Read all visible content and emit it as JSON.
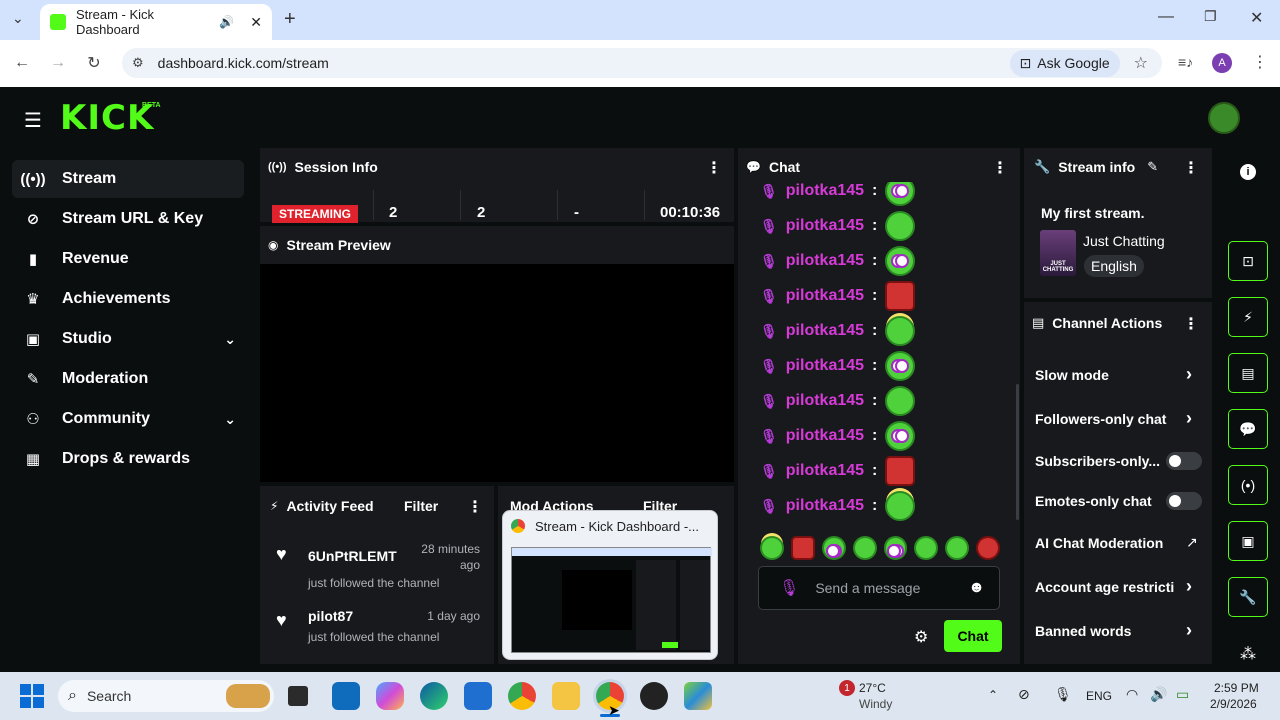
{
  "browser": {
    "tab_title": "Stream - Kick Dashboard",
    "url": "dashboard.kick.com/stream",
    "ask_google": "Ask Google",
    "profile_initial": "A"
  },
  "kick": {
    "logo": "KICK",
    "beta": "BETA"
  },
  "sidebar": {
    "items": [
      {
        "label": "Stream",
        "icon": "radio-icon"
      },
      {
        "label": "Stream URL & Key",
        "icon": "link-icon"
      },
      {
        "label": "Revenue",
        "icon": "chart-icon"
      },
      {
        "label": "Achievements",
        "icon": "trophy-icon"
      },
      {
        "label": "Studio",
        "icon": "studio-icon"
      },
      {
        "label": "Moderation",
        "icon": "wrench-icon"
      },
      {
        "label": "Community",
        "icon": "people-icon"
      },
      {
        "label": "Drops & rewards",
        "icon": "gift-icon"
      }
    ]
  },
  "session_info": {
    "title": "Session Info",
    "status": "STREAMING",
    "viewers": "2",
    "followers": "2",
    "subs": "-",
    "duration": "00:10:36"
  },
  "stream_preview": {
    "title": "Stream Preview"
  },
  "activity_feed": {
    "title": "Activity Feed",
    "filter": "Filter",
    "items": [
      {
        "user": "6UnPtRLEMT",
        "time": "28 minutes ago",
        "action": "just followed the channel"
      },
      {
        "user": "pilot87",
        "time": "1 day ago",
        "action": "just followed the channel"
      }
    ]
  },
  "mod_actions": {
    "title": "Mod Actions",
    "filter": "Filter"
  },
  "thumbnail_popup": {
    "title": "Stream - Kick Dashboard -..."
  },
  "chat": {
    "title": "Chat",
    "username": "pilotka145",
    "separator": ":",
    "input_placeholder": "Send a message",
    "send_label": "Chat"
  },
  "stream_info": {
    "title": "Stream info",
    "stream_title": "My first stream.",
    "category": "Just Chatting",
    "language": "English",
    "thumb_label": "JUST CHATTING"
  },
  "channel_actions": {
    "title": "Channel Actions",
    "items": [
      {
        "label": "Slow mode"
      },
      {
        "label": "Followers-only chat"
      },
      {
        "label": "Subscribers-only..."
      },
      {
        "label": "Emotes-only chat"
      },
      {
        "label": "AI Chat Moderation"
      },
      {
        "label": "Account age restricti"
      },
      {
        "label": "Banned words"
      }
    ]
  },
  "taskbar": {
    "search": "Search",
    "temp": "27°C",
    "weather": "Windy",
    "weather_badge": "1",
    "lang": "ENG",
    "time": "2:59 PM",
    "date": "2/9/2026"
  },
  "colors": {
    "kick_green": "#53fc18",
    "username_purple": "#d63bd8",
    "streaming_red": "#e0222c"
  }
}
